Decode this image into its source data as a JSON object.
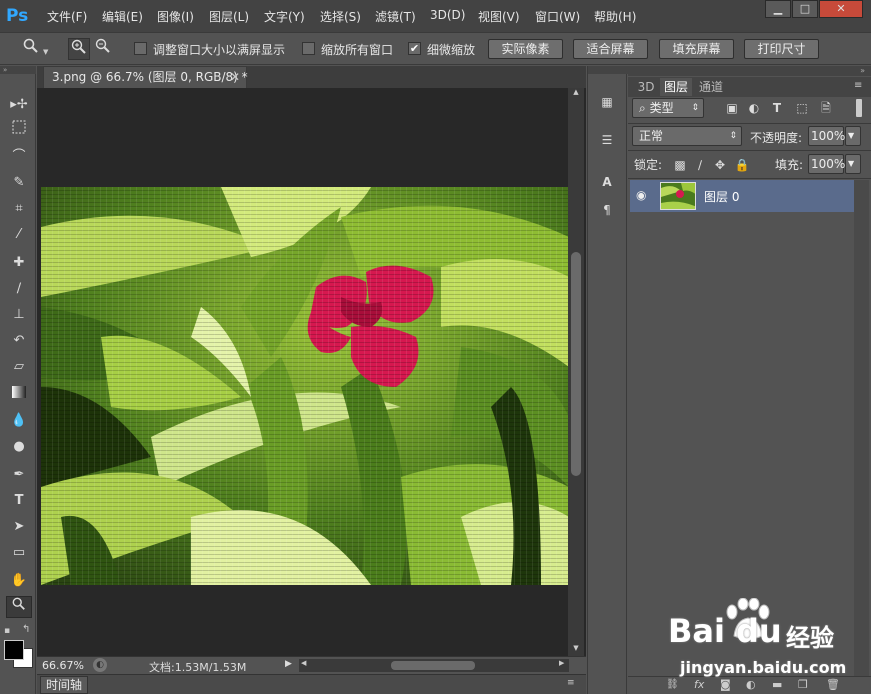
{
  "app": {
    "logo": "Ps"
  },
  "menu": [
    "文件(F)",
    "编辑(E)",
    "图像(I)",
    "图层(L)",
    "文字(Y)",
    "选择(S)",
    "滤镜(T)",
    "3D(D)",
    "视图(V)",
    "窗口(W)",
    "帮助(H)"
  ],
  "window_controls": {
    "minimize": "▁",
    "maximize": "□",
    "close": "✕"
  },
  "options": {
    "zoom_tool_icon": "zoom-icon",
    "resize_windows_label": "调整窗口大小以满屏显示",
    "resize_windows_checked": false,
    "zoom_all_label": "缩放所有窗口",
    "zoom_all_checked": false,
    "scrubby_label": "细微缩放",
    "scrubby_checked": true,
    "actual_pixels": "实际像素",
    "fit_screen": "适合屏幕",
    "fill_screen": "填充屏幕",
    "print_size": "打印尺寸"
  },
  "document": {
    "tab_title": "3.png @ 66.7% (图层 0, RGB/8) *",
    "zoom": "66.67%",
    "doc_size": "文档:1.53M/1.53M"
  },
  "timeline_label": "时间轴",
  "panel": {
    "tabs": [
      "3D",
      "图层",
      "通道"
    ],
    "active_tab": "图层",
    "filter_kind": "类型",
    "blend_mode": "正常",
    "opacity_label": "不透明度:",
    "opacity_value": "100%",
    "lock_label": "锁定:",
    "fill_label": "填充:",
    "fill_value": "100%",
    "layers": [
      {
        "name": "图层 0",
        "visible": true,
        "selected": true
      }
    ]
  },
  "watermark": {
    "brand": "Bai",
    "brand2": "du",
    "cn": "经验",
    "url": "jingyan.baidu.com"
  },
  "colors": {
    "accent": "#31a8ff",
    "selected_layer": "#5a6b8c",
    "flower": "#d6184f"
  }
}
